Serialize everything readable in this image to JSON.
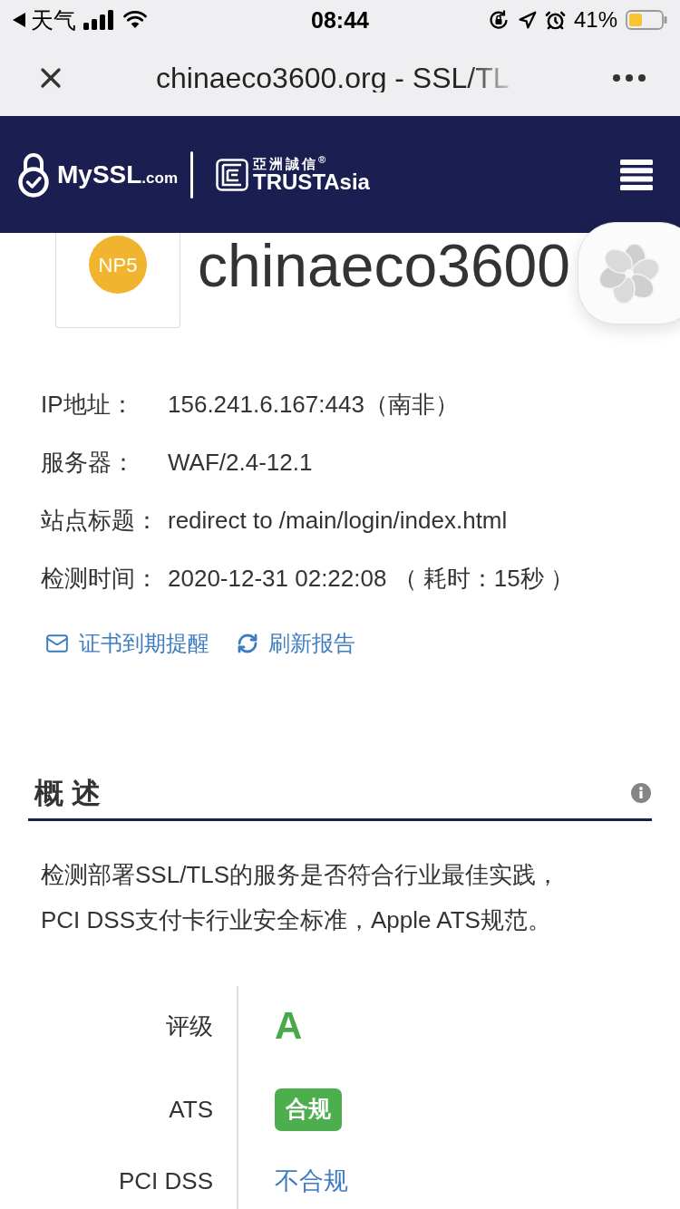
{
  "status_bar": {
    "back_label": "天气",
    "time": "08:44",
    "battery": "41%"
  },
  "browser_bar": {
    "title": "chinaeco3600.org - SSL/TL"
  },
  "header": {
    "brand": {
      "name": "MySSL",
      "suffix": ".com"
    },
    "partner": {
      "name_zh": "亞洲誠信$^{®}$",
      "name_en": "TRUSTAsia"
    }
  },
  "site": {
    "badge": "NP5",
    "name": "chinaeco3600"
  },
  "details": [
    {
      "label": "IP地址：",
      "value": "156.241.6.167:443（南非）"
    },
    {
      "label": "服务器：",
      "value": "WAF/2.4-12.1"
    },
    {
      "label": "站点标题：",
      "value": "redirect to /main/login/index.html"
    },
    {
      "label": "检测时间：",
      "value": "2020-12-31 02:22:08 （ 耗时：15秒 ）"
    }
  ],
  "actions": [
    {
      "kind": "mail",
      "label": "证书到期提醒"
    },
    {
      "kind": "refresh",
      "label": "刷新报告"
    }
  ],
  "overview": {
    "title": "概 述",
    "description": "检测部署SSL/TLS的服务是否符合行业最佳实践，PCI DSS支付卡行业安全标准，Apple ATS规范。",
    "results": [
      {
        "label": "评级",
        "kind": "grade",
        "value": "A"
      },
      {
        "label": "ATS",
        "kind": "badge",
        "value": "合规"
      },
      {
        "label": "PCI DSS",
        "kind": "link",
        "value": "不合规"
      }
    ]
  }
}
